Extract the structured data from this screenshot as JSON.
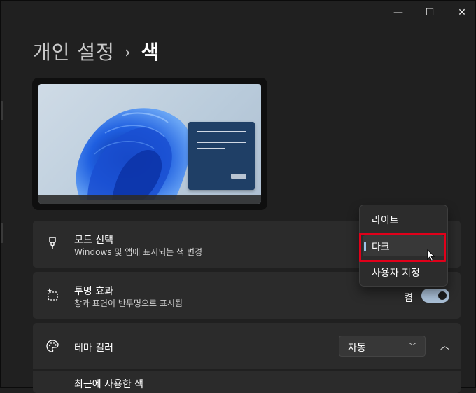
{
  "window_controls": {
    "minimize": "—",
    "maximize": "☐",
    "close": "✕"
  },
  "breadcrumb": {
    "parent": "개인 설정",
    "separator": "›",
    "current": "색"
  },
  "preview": {
    "window_color": "#1f3f66"
  },
  "mode": {
    "title": "모드 선택",
    "subtitle": "Windows 및 앱에 표시되는 색 변경"
  },
  "transparency": {
    "title": "투명 효과",
    "subtitle": "창과 표면이 반투명으로 표시됨",
    "state_label": "켬",
    "on": true
  },
  "theme_color": {
    "title": "테마 컬러",
    "selected": "자동",
    "recent_label": "최근에 사용한 색"
  },
  "mode_menu": {
    "options": [
      "라이트",
      "다크",
      "사용자 지정"
    ],
    "selected_index": 1
  },
  "colors": {
    "accent": "#9fc4ea",
    "highlight_box": "#e0001a"
  }
}
